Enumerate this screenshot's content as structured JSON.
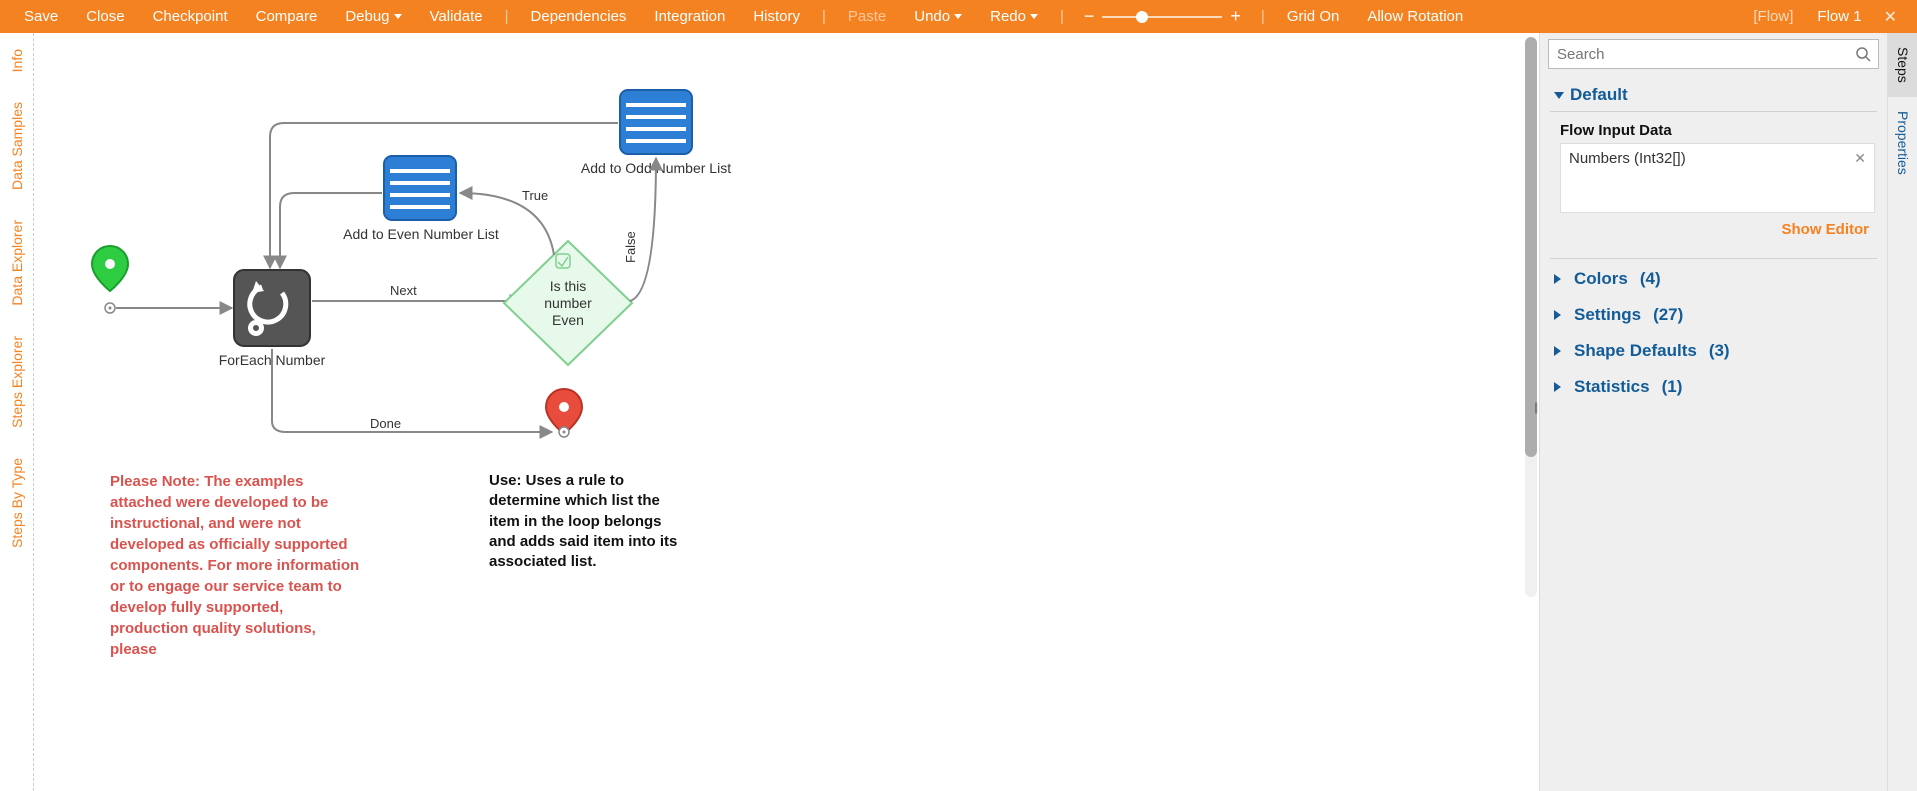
{
  "toolbar": {
    "save": "Save",
    "close": "Close",
    "checkpoint": "Checkpoint",
    "compare": "Compare",
    "debug": "Debug",
    "validate": "Validate",
    "dependencies": "Dependencies",
    "integration": "Integration",
    "history": "History",
    "paste": "Paste",
    "undo": "Undo",
    "redo": "Redo",
    "grid": "Grid On",
    "rotation": "Allow Rotation",
    "flow_type": "[Flow]",
    "flow_name": "Flow 1"
  },
  "left_tabs": [
    "Info",
    "Data Samples",
    "Data Explorer",
    "Steps Explorer",
    "Steps By Type"
  ],
  "right_tabs": [
    "Steps",
    "Properties"
  ],
  "nodes": {
    "foreach": "ForEach Number",
    "evenlist": "Add to Even Number List",
    "oddlist": "Add to Odd Number List",
    "decision1": "Is this",
    "decision2": "number",
    "decision3": "Even"
  },
  "edges": {
    "next": "Next",
    "done": "Done",
    "true": "True",
    "false": "False"
  },
  "notes": {
    "red": "Please Note: The examples attached were developed to be instructional, and were not developed as officially supported components.  For more information or to engage our service team to develop fully supported, production quality solutions, please",
    "black": "Use: Uses a rule to determine which list the item in the loop belongs and adds said item into its associated list."
  },
  "search": {
    "placeholder": "Search"
  },
  "panel": {
    "default": "Default",
    "flow_input": "Flow Input Data",
    "input_item": "Numbers (Int32[])",
    "show_editor": "Show Editor",
    "colors": "Colors",
    "colors_n": "(4)",
    "settings": "Settings",
    "settings_n": "(27)",
    "shape": "Shape Defaults",
    "shape_n": "(3)",
    "stats": "Statistics",
    "stats_n": "(1)"
  }
}
